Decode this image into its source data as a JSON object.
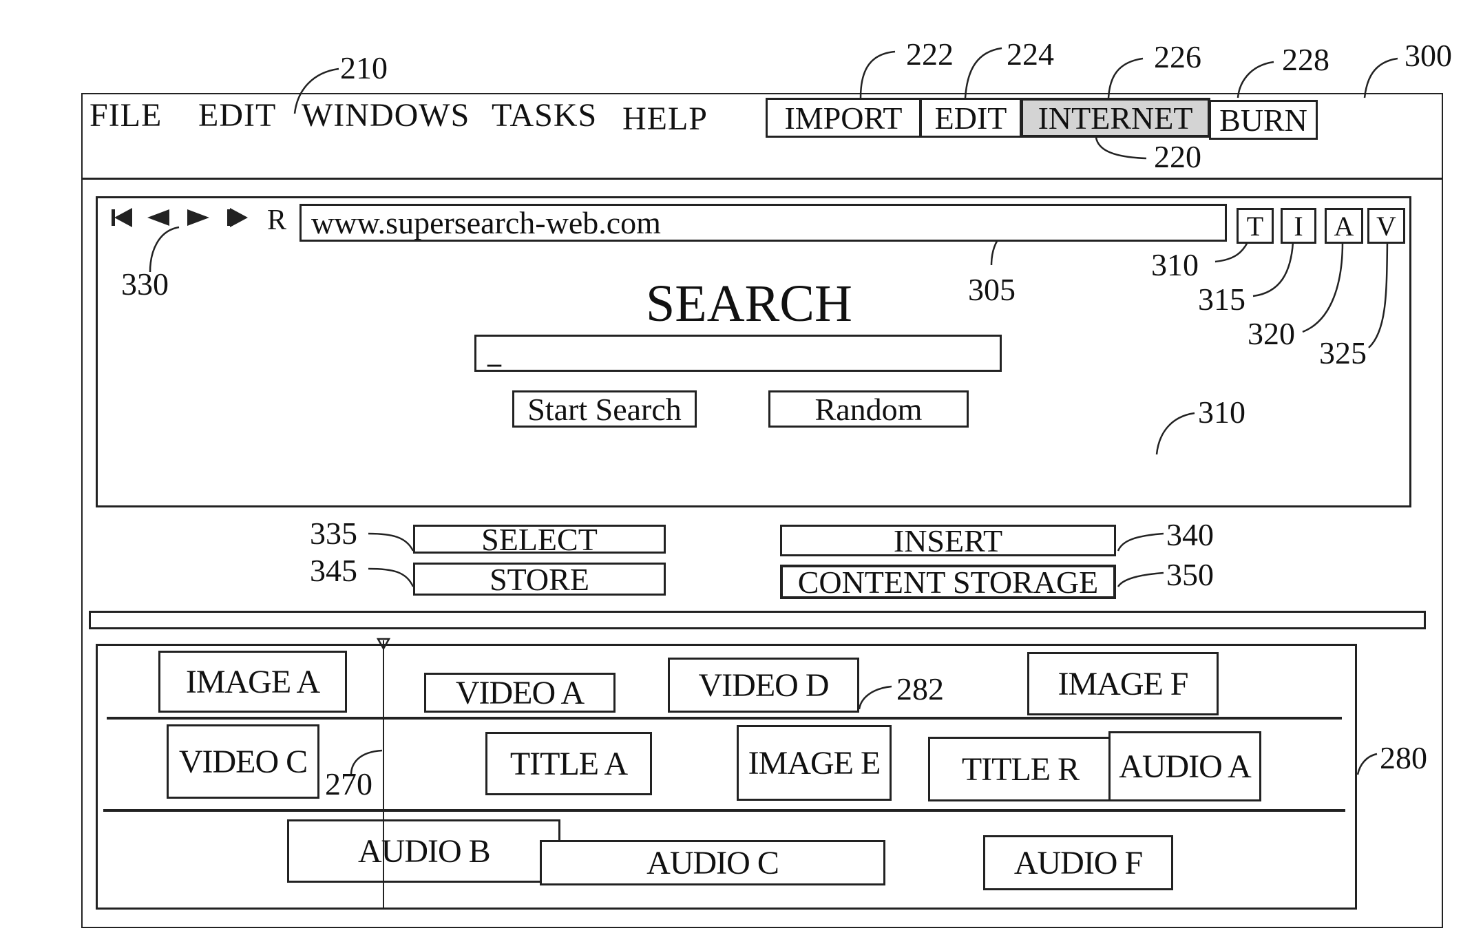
{
  "menubar": {
    "items": [
      "FILE",
      "EDIT",
      "WINDOWS",
      "TASKS",
      "HELP"
    ]
  },
  "mode_tabs": [
    {
      "label": "IMPORT",
      "ref": "222",
      "active": false
    },
    {
      "label": "EDIT",
      "ref": "224",
      "active": false
    },
    {
      "label": "INTERNET",
      "ref": "226",
      "active": true
    },
    {
      "label": "BURN",
      "ref": "228",
      "active": false
    }
  ],
  "browser": {
    "nav_icons": [
      "rewind-icon",
      "back-icon",
      "forward-icon",
      "fast-forward-icon"
    ],
    "refresh_label": "R",
    "url": "www.supersearch-web.com",
    "filters": [
      "T",
      "I",
      "A",
      "V"
    ],
    "search_title": "SEARCH",
    "search_value": "_",
    "start_search_label": "Start Search",
    "random_label": "Random"
  },
  "actions": {
    "select_label": "SELECT",
    "store_label": "STORE",
    "insert_label": "INSERT",
    "content_storage_label": "CONTENT STORAGE"
  },
  "timeline": {
    "tracks": [
      [
        "IMAGE A",
        "VIDEO A",
        "VIDEO D",
        "IMAGE F"
      ],
      [
        "VIDEO C",
        "TITLE A",
        "IMAGE E",
        "TITLE R",
        "AUDIO A"
      ],
      [
        "AUDIO B",
        "AUDIO C",
        "AUDIO F"
      ]
    ]
  },
  "refs": {
    "r210": "210",
    "r222": "222",
    "r224": "224",
    "r226": "226",
    "r228": "228",
    "r300": "300",
    "r220": "220",
    "r330": "330",
    "r305": "305",
    "r310a": "310",
    "r315": "315",
    "r320": "320",
    "r325": "325",
    "r310b": "310",
    "r335": "335",
    "r345": "345",
    "r340": "340",
    "r350": "350",
    "r282": "282",
    "r270": "270",
    "r280": "280"
  },
  "colors": {
    "active_tab": "#d4d4d4",
    "ink": "#222222"
  }
}
